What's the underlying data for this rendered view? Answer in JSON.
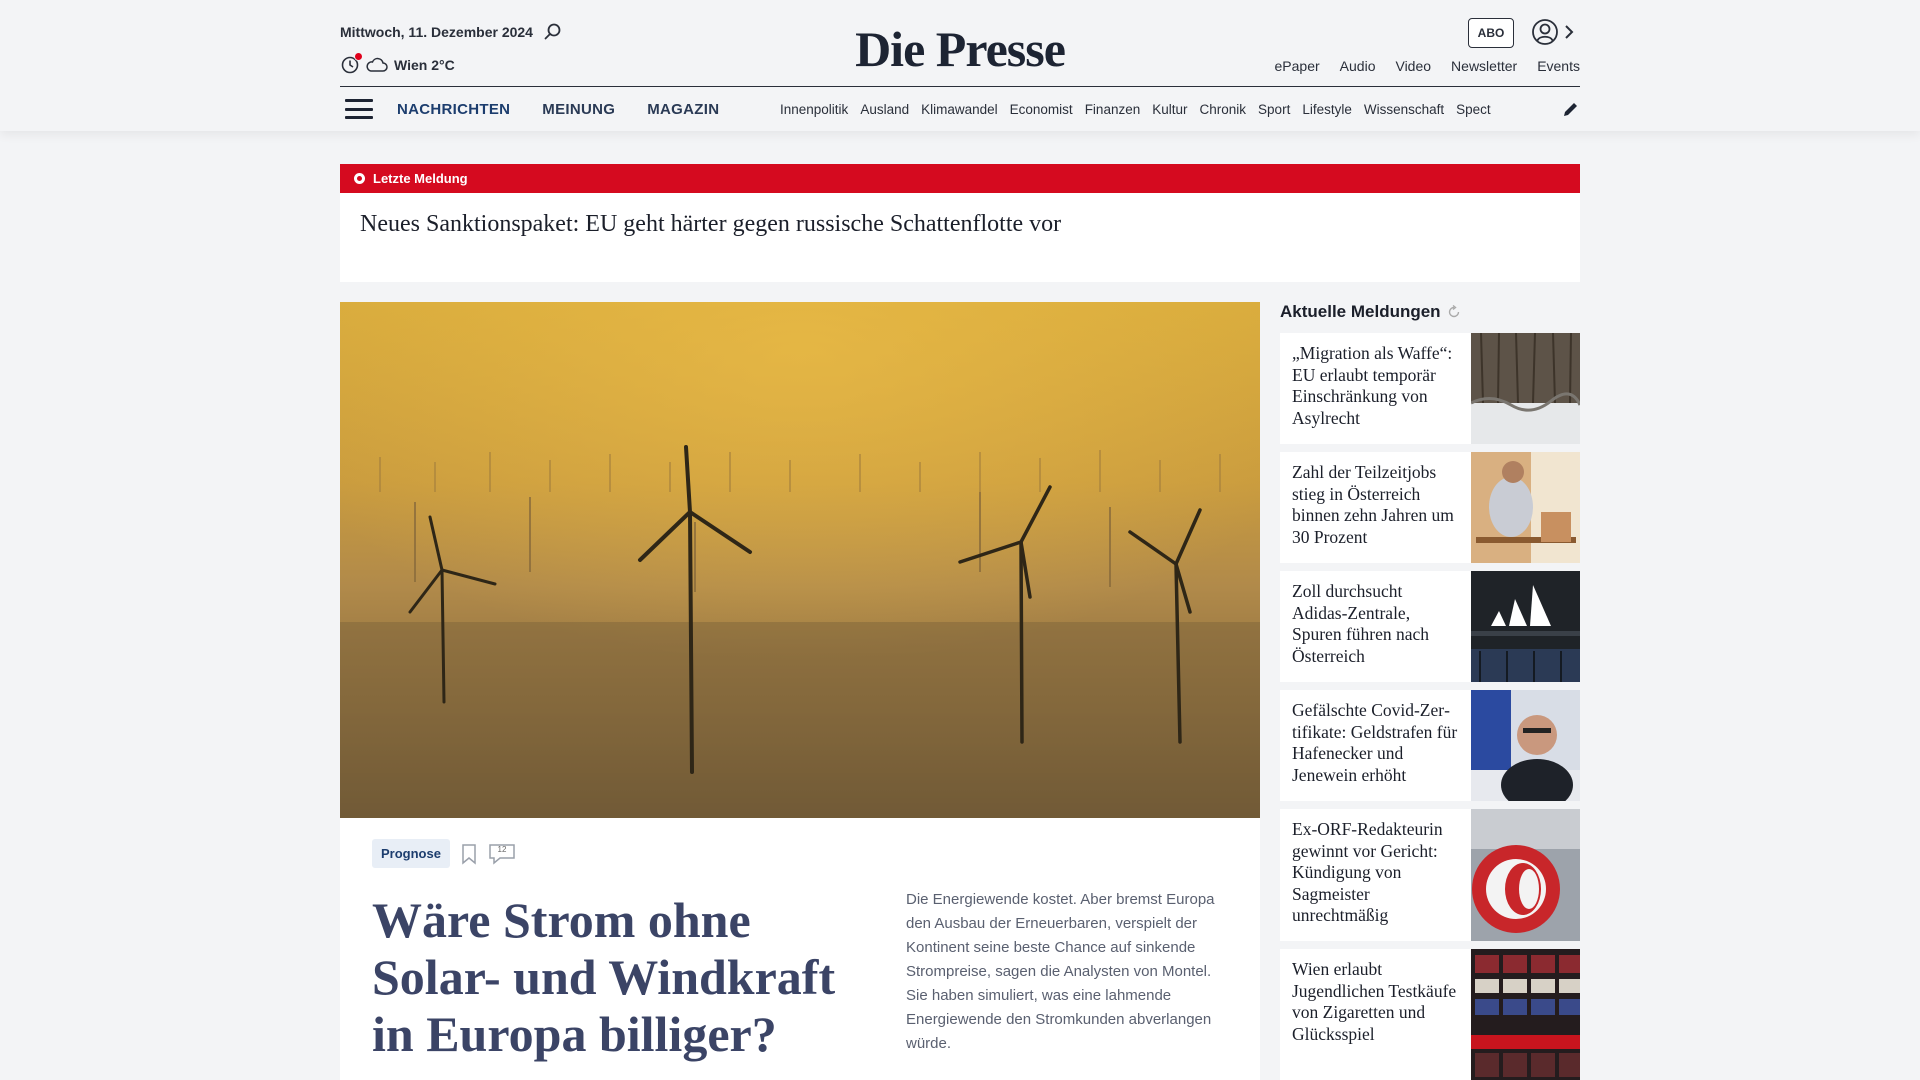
{
  "header": {
    "date": "Mittwoch, 11. Dezember 2024",
    "weather": "Wien 2°C",
    "logo": "Die Presse",
    "abo_label": "ABO",
    "top_links": [
      "ePaper",
      "Audio",
      "Video",
      "Newsletter",
      "Events"
    ],
    "main_nav": [
      "NACHRICHTEN",
      "MEINUNG",
      "MAGAZIN"
    ],
    "sub_nav": [
      "Innenpolitik",
      "Ausland",
      "Klimawandel",
      "Economist",
      "Finanzen",
      "Kultur",
      "Chronik",
      "Sport",
      "Lifestyle",
      "Wissenschaft",
      "Spect"
    ]
  },
  "breaking": {
    "label": "Letzte Meldung",
    "title": "Neues Sanktionspaket: EU geht härter gegen russische Schattenflotte vor"
  },
  "lead": {
    "tag": "Prognose",
    "comment_count": "12",
    "headline": "Wäre Strom ohne Solar- und Windkraft in Europa billiger?",
    "teaser": "Die Energiewende kostet. Aber bremst Europa den Ausbau der Erneuerbaren, verspielt der Kontinent seine beste Chance auf sinkende Strompreise, sagen die Analysten von Montel. Sie haben simuliert, was eine lahmende Energiewende den Stromkunden abverlangen würde."
  },
  "sidebar": {
    "title": "Aktuelle Meldungen",
    "items": [
      {
        "text": "„Migration als Waffe“: EU erlaubt temporär Einschrän­kung von Asylrecht"
      },
      {
        "text": "Zahl der Teilzeitjobs stieg in Österreich binnen zehn Jahren um 30 Prozent"
      },
      {
        "text": "Zoll durchsucht Adidas-Zentrale, Spuren führen nach Österreich"
      },
      {
        "text": "Gefälschte Covid-Zer­tifikate: Geldstrafen für Hafenecker und Jenewein erhöht"
      },
      {
        "text": "Ex-ORF-Redakteurin gewinnt vor Gericht: Kündigung von Sagmeister unrechtmäßig"
      },
      {
        "text": "Wien erlaubt Jugendlichen Testkäufe von Zigaretten und Glücksspiel"
      }
    ]
  },
  "colors": {
    "breaking_red": "#d50a1f",
    "nav_blue": "#1c3d6e",
    "headline_blue": "#3b4466"
  }
}
